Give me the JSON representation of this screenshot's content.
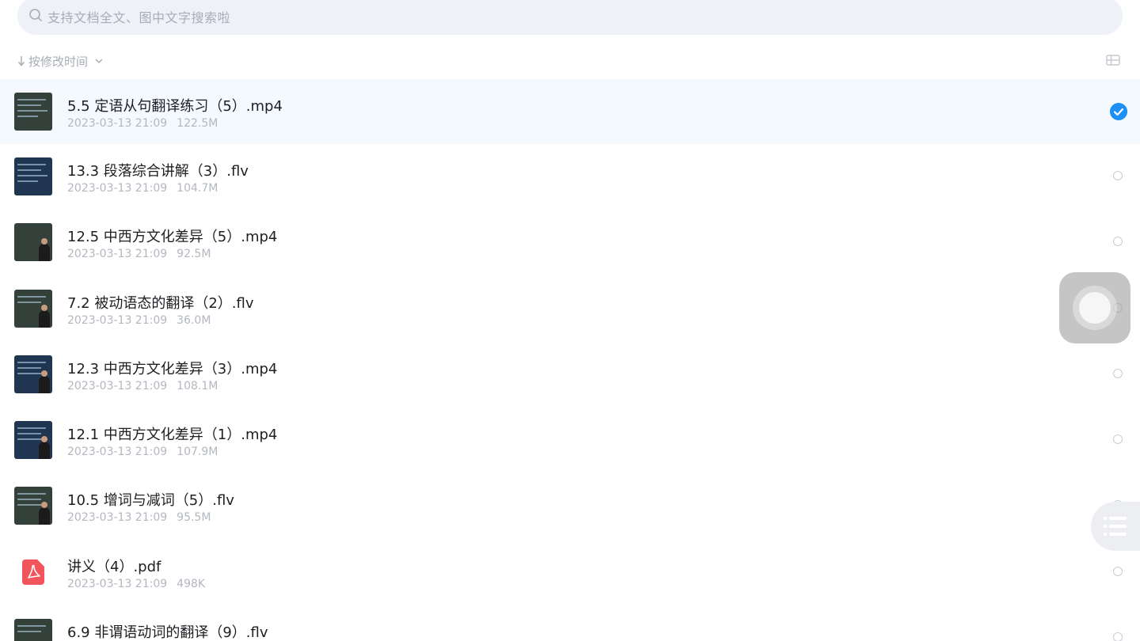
{
  "search": {
    "placeholder": "支持文档全文、图中文字搜索啦"
  },
  "sort": {
    "label": "按修改时间"
  },
  "files": [
    {
      "name": "5.5 定语从句翻译练习（5）.mp4",
      "date": "2023-03-13 21:09",
      "size": "122.5M",
      "type": "video",
      "selected": true
    },
    {
      "name": "13.3 段落综合讲解（3）.flv",
      "date": "2023-03-13 21:09",
      "size": "104.7M",
      "type": "video",
      "selected": false
    },
    {
      "name": "12.5 中西方文化差异（5）.mp4",
      "date": "2023-03-13 21:09",
      "size": "92.5M",
      "type": "video",
      "selected": false
    },
    {
      "name": "7.2 被动语态的翻译（2）.flv",
      "date": "2023-03-13 21:09",
      "size": "36.0M",
      "type": "video",
      "selected": false
    },
    {
      "name": "12.3 中西方文化差异（3）.mp4",
      "date": "2023-03-13 21:09",
      "size": "108.1M",
      "type": "video",
      "selected": false
    },
    {
      "name": "12.1 中西方文化差异（1）.mp4",
      "date": "2023-03-13 21:09",
      "size": "107.9M",
      "type": "video",
      "selected": false
    },
    {
      "name": "10.5 增词与减词（5）.flv",
      "date": "2023-03-13 21:09",
      "size": "95.5M",
      "type": "video",
      "selected": false
    },
    {
      "name": "讲义（4）.pdf",
      "date": "2023-03-13 21:09",
      "size": "498K",
      "type": "pdf",
      "selected": false
    },
    {
      "name": "6.9 非谓语动词的翻译（9）.flv",
      "date": "",
      "size": "",
      "type": "video",
      "selected": false
    }
  ],
  "colors": {
    "accent": "#1e8ff5",
    "pdf": "#f2545b",
    "search_bg": "#eef1f8",
    "selected_row_bg": "#f4f9fe"
  },
  "icons": {
    "search": "search-icon",
    "sort_arrow": "arrow-down-icon",
    "sort_dropdown": "chevron-down-icon",
    "view_toggle": "list-view-icon",
    "selected": "checkmark-circle-icon",
    "pdf": "pdf-icon",
    "assistive_touch": "assistive-touch-icon",
    "float_list": "list-icon"
  }
}
